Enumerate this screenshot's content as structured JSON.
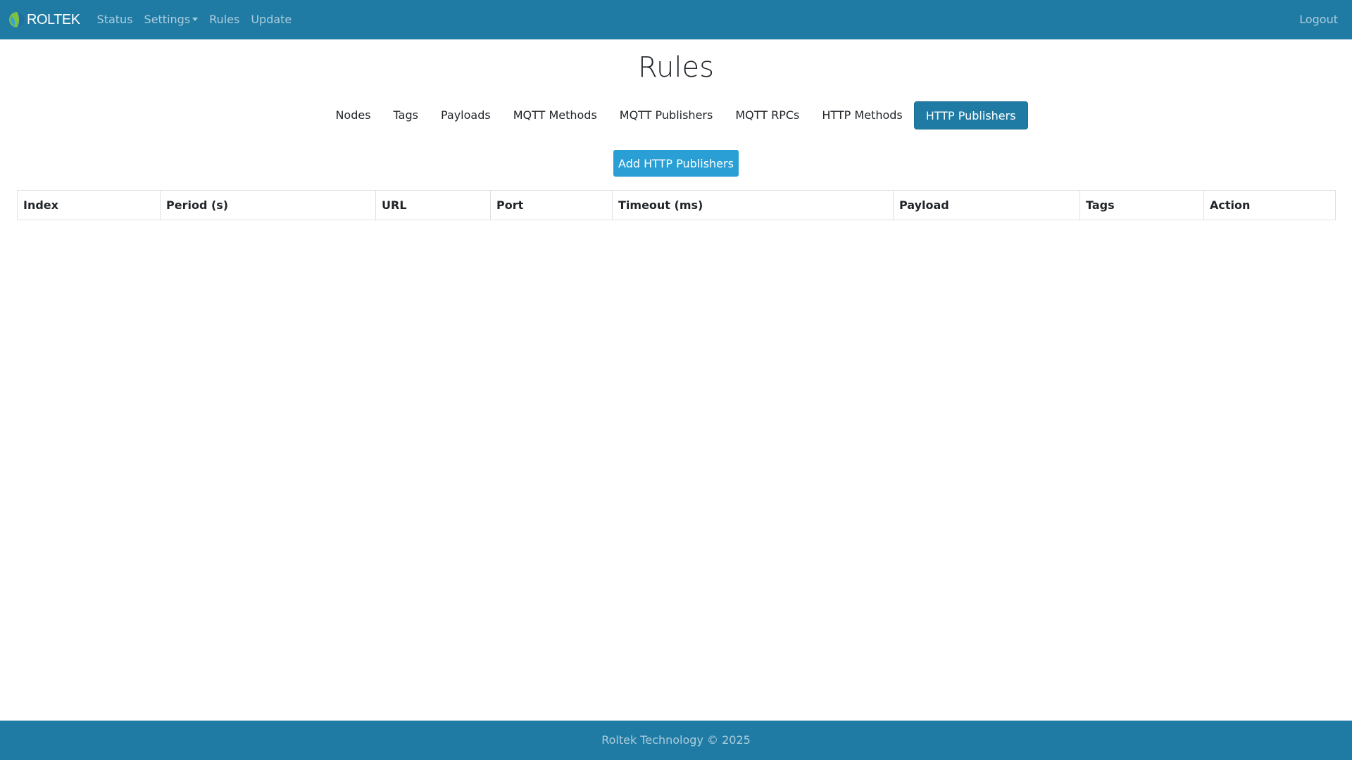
{
  "navbar": {
    "brand": "ROLTEK",
    "links": {
      "status": "Status",
      "settings": "Settings",
      "rules": "Rules",
      "update": "Update"
    },
    "logout": "Logout",
    "colors": {
      "background": "#207ba4"
    }
  },
  "page": {
    "title": "Rules"
  },
  "tabs": {
    "nodes": "Nodes",
    "tags": "Tags",
    "payloads": "Payloads",
    "mqtt_methods": "MQTT Methods",
    "mqtt_publishers": "MQTT Publishers",
    "mqtt_rpcs": "MQTT RPCs",
    "http_methods": "HTTP Methods",
    "http_publishers": "HTTP Publishers",
    "active": "HTTP Publishers"
  },
  "actions": {
    "add_label": "Add HTTP Publishers",
    "add_color": "#2a9fd6"
  },
  "table": {
    "columns": {
      "index": "Index",
      "period": "Period (s)",
      "url": "URL",
      "port": "Port",
      "timeout": "Timeout (ms)",
      "payload": "Payload",
      "tags": "Tags",
      "action": "Action"
    },
    "rows": []
  },
  "footer": {
    "text": "Roltek Technology © 2025"
  }
}
